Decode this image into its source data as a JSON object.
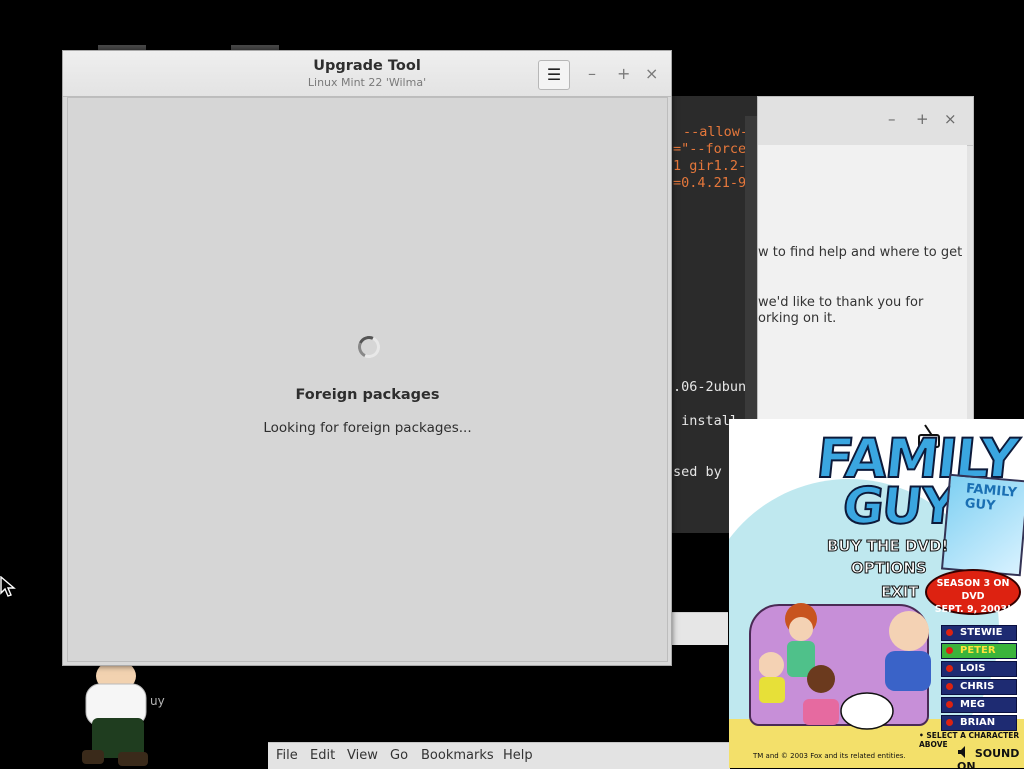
{
  "upgrade_tool": {
    "title": "Upgrade Tool",
    "subtitle": "Linux Mint 22 'Wilma'",
    "menu_icon": "hamburger-icon",
    "minimize": "–",
    "maximize": "+",
    "close": "×",
    "heading": "Foreign packages",
    "status": "Looking for foreign packages..."
  },
  "terminal": {
    "lines": [
      "--allow-",
      "=\"--force",
      "1 gir1.2-",
      "=0.4.21-9",
      ".06-2ubun",
      " install",
      "sed by"
    ]
  },
  "welcome_window": {
    "minimize": "–",
    "maximize": "+",
    "close": "×",
    "text_lines": [
      "w to find help and where to get",
      "we'd like to thank you for",
      "orking on it."
    ]
  },
  "desktop": {
    "partial_label": "uy"
  },
  "file_manager_menu": [
    "File",
    "Edit",
    "View",
    "Go",
    "Bookmarks",
    "Help"
  ],
  "family_guy_menu": {
    "logo_line1": "FAMILY",
    "logo_line2": "GUY",
    "options": [
      "BUY THE DVD!",
      "OPTIONS",
      "EXIT"
    ],
    "dvd_cover_text": "FAMILY GUY",
    "badge_line1": "SEASON 3 ON DVD",
    "badge_line2": "SEPT. 9, 2003!",
    "characters": [
      "STEWIE",
      "PETER",
      "LOIS",
      "CHRIS",
      "MEG",
      "BRIAN"
    ],
    "selected_character": "PETER",
    "select_prompt": "• SELECT A CHARACTER ABOVE",
    "copyright": "TM and © 2003 Fox and its related entities.",
    "sound_toggle": "SOUND ON",
    "colors": {
      "logo": "#3aa6e0",
      "character_button": "#1e2b72",
      "selected_button": "#3bb43b",
      "badge": "#dd2211"
    }
  }
}
